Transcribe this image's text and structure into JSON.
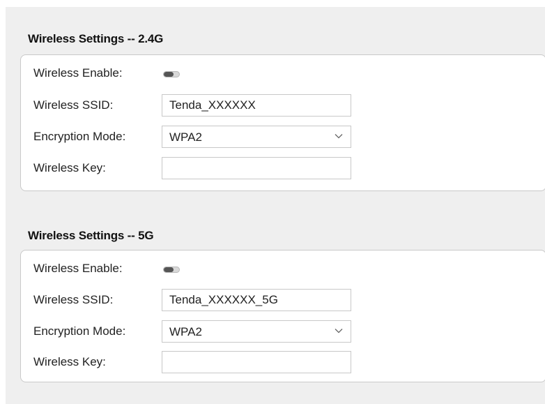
{
  "sections": [
    {
      "title": "Wireless Settings -- 2.4G",
      "enable_label": "Wireless Enable:",
      "ssid_label": "Wireless SSID:",
      "ssid_value": "Tenda_XXXXXX",
      "encryption_label": "Encryption Mode:",
      "encryption_value": "WPA2",
      "key_label": "Wireless Key:",
      "key_value": ""
    },
    {
      "title": "Wireless Settings -- 5G",
      "enable_label": "Wireless Enable:",
      "ssid_label": "Wireless SSID:",
      "ssid_value": "Tenda_XXXXXX_5G",
      "encryption_label": "Encryption Mode:",
      "encryption_value": "WPA2",
      "key_label": "Wireless Key:",
      "key_value": ""
    }
  ],
  "icons": {
    "toggle": "toggle-switch-icon",
    "dropdown": "chevron-down-icon"
  },
  "colors": {
    "panel_bg": "#efefef",
    "card_bg": "#ffffff",
    "border": "#c8c8c8"
  }
}
